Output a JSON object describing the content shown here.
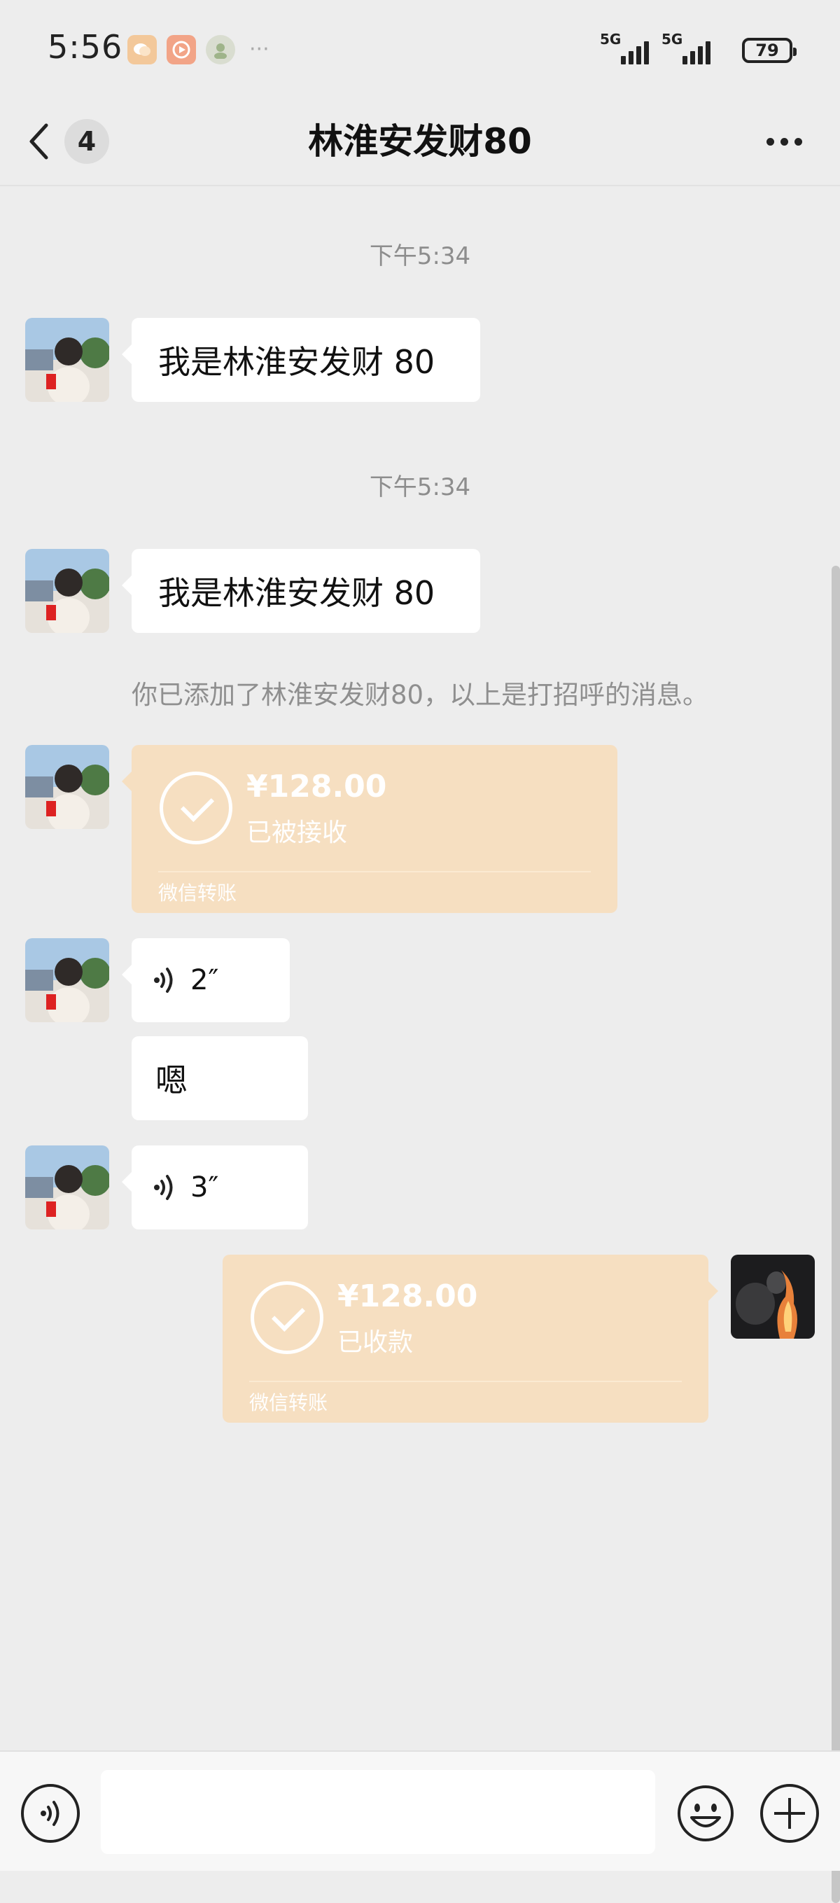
{
  "status_bar": {
    "time": "5:56",
    "network_1": "5G",
    "network_2": "5G",
    "battery": "79",
    "more_dots": "···",
    "app_icons": [
      "chat-app-icon",
      "video-app-icon",
      "avatar-app-icon"
    ]
  },
  "header": {
    "back_icon": "chevron-left-icon",
    "unread_count": "4",
    "title": "林淮安发财80",
    "more_icon": "more-dots-icon"
  },
  "messages": {
    "timestamp_1": "下午5:34",
    "text_1": "我是林淮安发财 80",
    "timestamp_2": "下午5:34",
    "text_2": "我是林淮安发财 80",
    "system_notice": "你已添加了林淮安发财80，以上是打招呼的消息。",
    "transfer_1": {
      "amount": "¥128.00",
      "state": "已被接收",
      "label": "微信转账"
    },
    "voice_1": {
      "duration": "2″"
    },
    "text_3": "嗯",
    "voice_2": {
      "duration": "3″"
    },
    "transfer_2": {
      "amount": "¥128.00",
      "state": "已收款",
      "label": "微信转账"
    }
  },
  "input_bar": {
    "voice_icon": "voice-icon",
    "input_value": "",
    "emoji_icon": "emoji-icon",
    "plus_icon": "plus-icon"
  },
  "colors": {
    "background": "#ededed",
    "bubble": "#ffffff",
    "transfer": "#f6dfc1",
    "timestamp": "#8d8d8d"
  }
}
